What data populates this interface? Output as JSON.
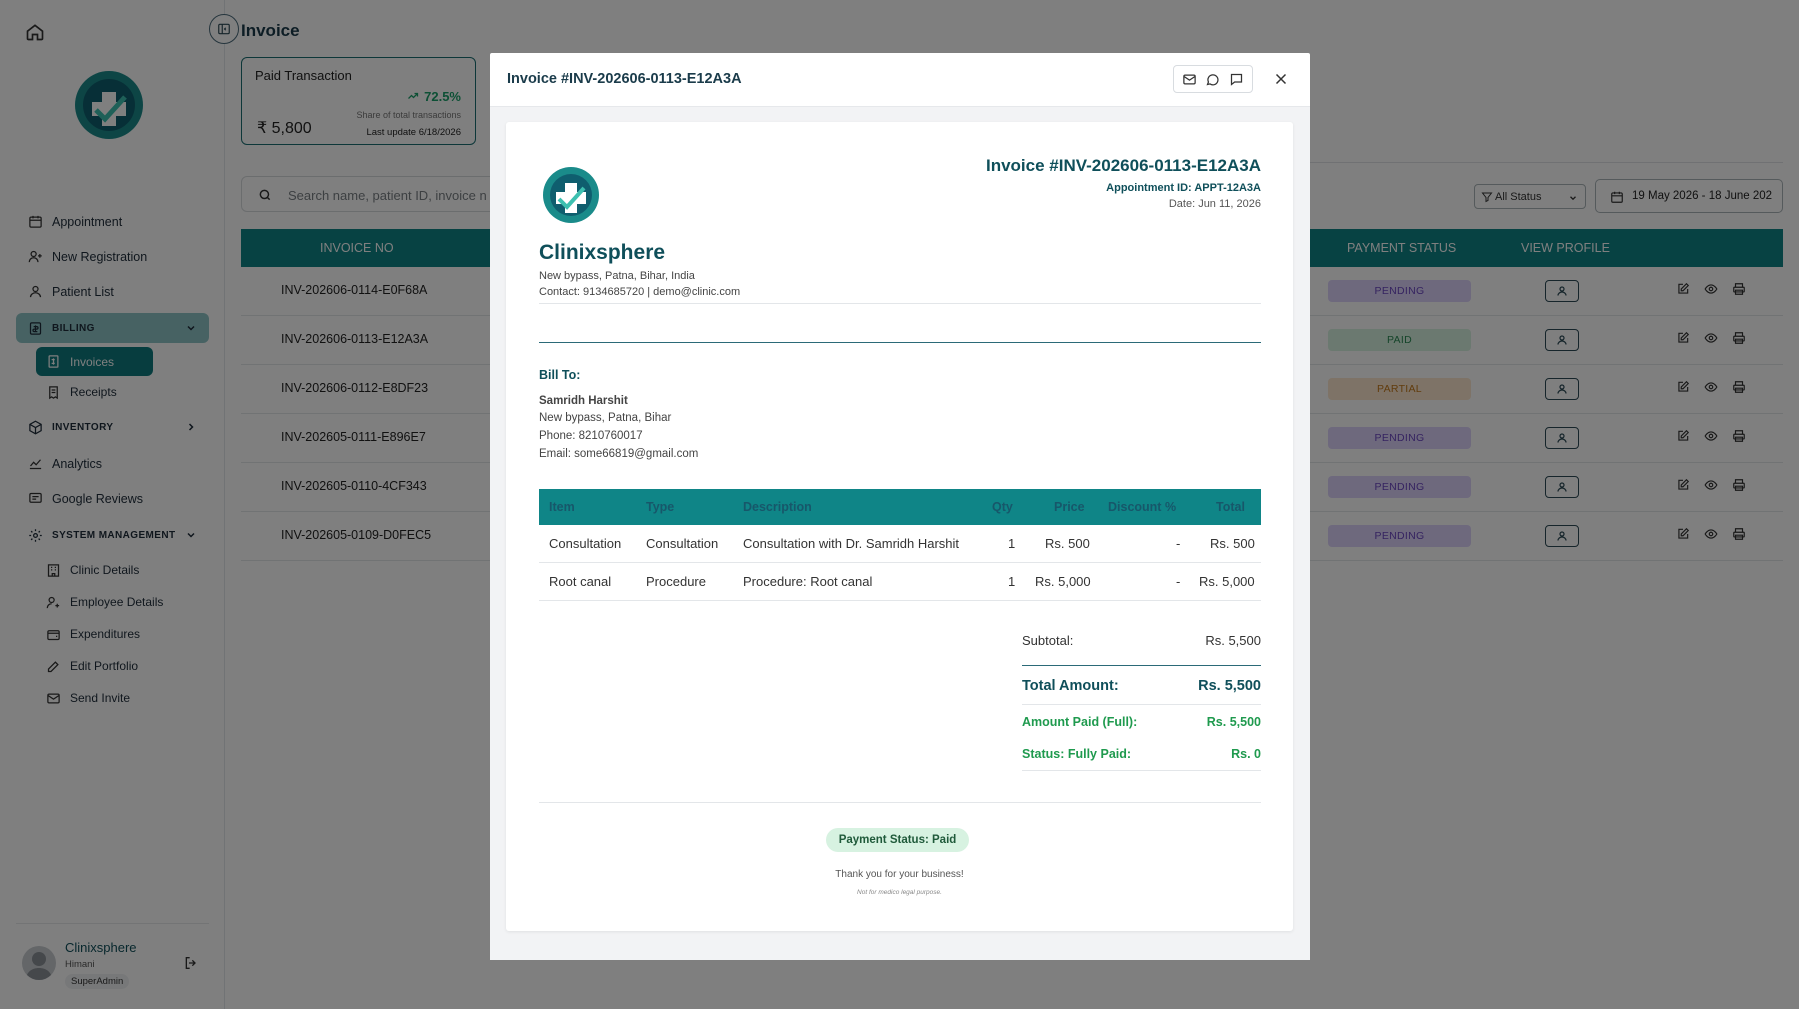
{
  "sidebar": {
    "nav": [
      {
        "label": "Appointment",
        "icon": "calendar-icon"
      },
      {
        "label": "New Registration",
        "icon": "user-plus-icon"
      },
      {
        "label": "Patient List",
        "icon": "user-icon"
      }
    ],
    "billing": {
      "label": "BILLING",
      "items": [
        "Invoices",
        "Receipts"
      ]
    },
    "inventory": {
      "label": "INVENTORY"
    },
    "analytics": "Analytics",
    "google_reviews": "Google Reviews",
    "system": {
      "label": "SYSTEM MANAGEMENT",
      "items": [
        "Clinic Details",
        "Employee Details",
        "Expenditures",
        "Edit Portfolio",
        "Send Invite"
      ]
    },
    "profile": {
      "name": "Clinixsphere",
      "user": "Himani",
      "role": "SuperAdmin"
    }
  },
  "page": {
    "title": "Invoice",
    "stat": {
      "title": "Paid Transaction",
      "percent": "72.5%",
      "share_label": "Share of total transactions",
      "amount": "₹ 5,800",
      "updated": "Last update 6/18/2026"
    },
    "search_placeholder": "Search name, patient ID, invoice n",
    "status_filter": "All Status",
    "date_range": "19 May 2026 - 18 June 202",
    "columns": {
      "invoice_no": "INVOICE NO",
      "payment_status": "PAYMENT STATUS",
      "view_profile": "VIEW PROFILE"
    },
    "rows": [
      {
        "invoice": "INV-202606-0114-E0F68A",
        "status": "PENDING"
      },
      {
        "invoice": "INV-202606-0113-E12A3A",
        "status": "PAID"
      },
      {
        "invoice": "INV-202606-0112-E8DF23",
        "status": "PARTIAL"
      },
      {
        "invoice": "INV-202605-0111-E896E7",
        "status": "PENDING"
      },
      {
        "invoice": "INV-202605-0110-4CF343",
        "status": "PENDING"
      },
      {
        "invoice": "INV-202605-0109-D0FEC5",
        "status": "PENDING"
      }
    ]
  },
  "modal": {
    "title": "Invoice #INV-202606-0113-E12A3A",
    "clinic_name": "Clinixsphere",
    "address": "New bypass, Patna, Bihar, India",
    "contact": "Contact: 9134685720 | demo@clinic.com",
    "invoice_no": "Invoice #INV-202606-0113-E12A3A",
    "appointment_id": "Appointment ID: APPT-12A3A",
    "date": "Date: Jun 11, 2026",
    "bill_to_label": "Bill To:",
    "patient": {
      "name": "Samridh Harshit",
      "address": "New bypass, Patna, Bihar",
      "phone": "Phone: 8210760017",
      "email": "Email: some66819@gmail.com"
    },
    "columns": [
      "Item",
      "Type",
      "Description",
      "Qty",
      "Price",
      "Discount %",
      "Total"
    ],
    "items": [
      {
        "item": "Consultation",
        "type": "Consultation",
        "description": "Consultation with Dr. Samridh Harshit",
        "qty": "1",
        "price": "Rs. 500",
        "discount": "-",
        "total": "Rs. 500"
      },
      {
        "item": "Root canal",
        "type": "Procedure",
        "description": "Procedure: Root canal",
        "qty": "1",
        "price": "Rs. 5,000",
        "discount": "-",
        "total": "Rs. 5,000"
      }
    ],
    "totals": {
      "subtotal_label": "Subtotal:",
      "subtotal": "Rs. 5,500",
      "total_label": "Total Amount:",
      "total": "Rs. 5,500",
      "paid_label": "Amount Paid (Full):",
      "paid": "Rs. 5,500",
      "status_label": "Status: Fully Paid:",
      "status_value": "Rs. 0"
    },
    "payment_status": "Payment Status: Paid",
    "thanks": "Thank you for your business!",
    "disclaimer": "Not for medico legal purpose."
  },
  "colors": {
    "brand": "#0f8587",
    "pending": "#ddd3fb",
    "paid": "#d7f2e1",
    "partial": "#fde6cf",
    "accent_green": "#1f9a4e"
  }
}
